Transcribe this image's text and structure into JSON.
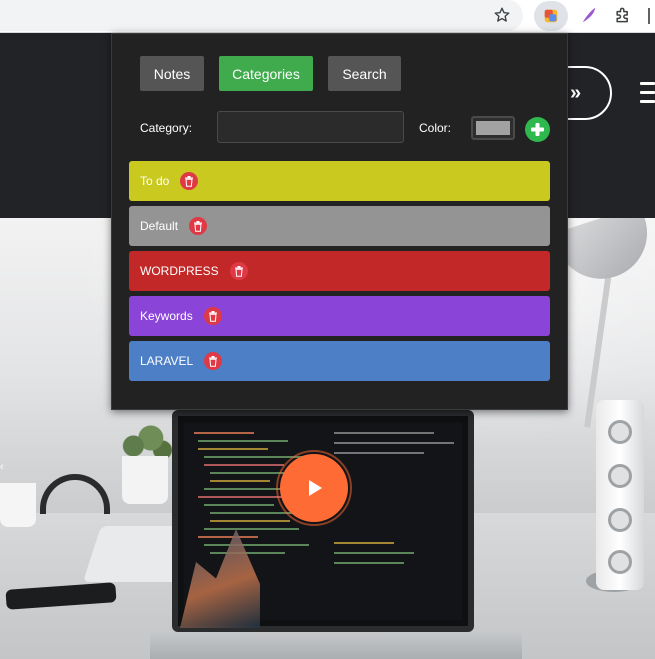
{
  "browser": {
    "icons": [
      "star-icon",
      "notes-extension-icon",
      "feather-extension-icon",
      "puzzle-extensions-icon"
    ]
  },
  "site": {
    "header_button_text": "»",
    "play_icon": "play-icon"
  },
  "popup": {
    "tabs": [
      {
        "label": "Notes",
        "active": false
      },
      {
        "label": "Categories",
        "active": true
      },
      {
        "label": "Search",
        "active": false
      }
    ],
    "form": {
      "category_label": "Category:",
      "category_value": "",
      "color_label": "Color:",
      "color_value": "#a2a2a2"
    },
    "categories": [
      {
        "name": "To do",
        "color": "#c9c91f"
      },
      {
        "name": "Default",
        "color": "#949494"
      },
      {
        "name": "WORDPRESS",
        "color": "#c22828"
      },
      {
        "name": "Keywords",
        "color": "#8a44d8"
      },
      {
        "name": "LARAVEL",
        "color": "#4d7fc7"
      }
    ]
  },
  "colors": {
    "tab_active": "#3fab4c",
    "tab_inactive": "#555555",
    "popup_bg": "#222222",
    "trash": "#e03946",
    "add": "#2fb84d",
    "play": "#ff6b35"
  }
}
